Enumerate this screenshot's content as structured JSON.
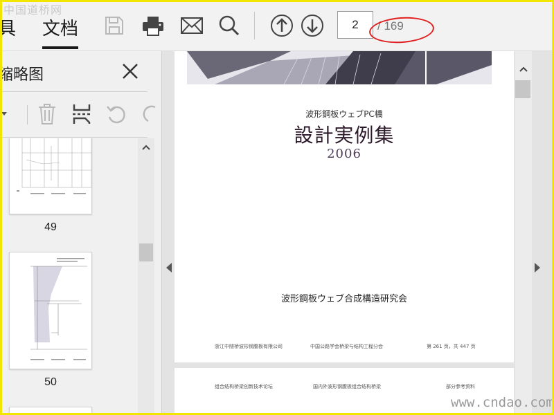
{
  "watermark_top": "中国道桥网",
  "watermark_bottom": "www.cndao.com",
  "toolbar": {
    "tab_tools": "具",
    "tab_document": "文档",
    "icons": [
      "save-icon",
      "print-icon",
      "mail-icon",
      "search-icon",
      "arrow-up-circle-icon",
      "arrow-down-circle-icon"
    ],
    "current_page": "2",
    "total_pages": "/ 169"
  },
  "sidebar": {
    "title": "缩略图",
    "close_icon": "close-icon",
    "tools": [
      "dropdown-icon",
      "delete-icon",
      "extract-icon",
      "rotate-icon"
    ],
    "thumbnails": [
      {
        "number": "49"
      },
      {
        "number": "50"
      }
    ]
  },
  "document": {
    "subtitle": "波形鋼板ウェブPC橋",
    "title": "設計実例集",
    "year": "2006",
    "organization": "波形鋼板ウェブ合成構造研究会",
    "footer": [
      "浙江中隧桥波形钢腹板有限公司",
      "中国公路学会桥梁与结构工程分会",
      "第 261 页，共 447 页"
    ],
    "next_page_footer": [
      "组合结构桥梁创新技术论坛",
      "国内外波形钢腹板组合结构桥梁",
      "部分参考资料"
    ]
  },
  "colors": {
    "annotation_oval": "#e02020",
    "frame_border": "#f2e500"
  }
}
